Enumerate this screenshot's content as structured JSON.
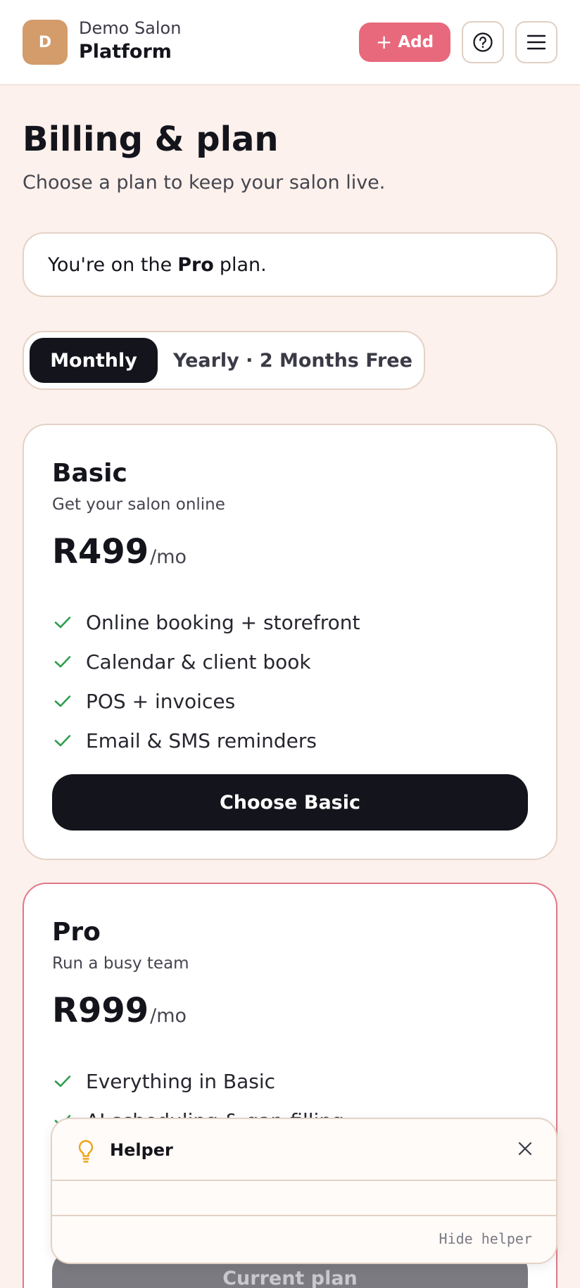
{
  "header": {
    "avatar_initial": "D",
    "salon_name": "Demo Salon",
    "app_title": "Platform",
    "add_label": "Add",
    "icons": {
      "add": "plus-icon",
      "help": "question-circle-icon",
      "menu": "hamburger-menu-icon"
    }
  },
  "page": {
    "title": "Billing & plan",
    "subtitle": "Choose a plan to keep your salon live."
  },
  "banner": {
    "prefix": "You're on the",
    "plan": "Pro",
    "suffix": "plan."
  },
  "billing_toggle": {
    "monthly": "Monthly",
    "yearly": "Yearly · 2 Months Free",
    "selected": "Monthly"
  },
  "plans": [
    {
      "name": "Basic",
      "description": "Get your salon online",
      "price": "R499",
      "unit": "/mo",
      "features": [
        "Online booking + storefront",
        "Calendar & client book",
        "POS + invoices",
        "Email & SMS reminders"
      ],
      "cta": "Choose Basic"
    },
    {
      "name": "Pro",
      "description": "Run a busy team",
      "price": "R999",
      "unit": "/mo",
      "features": [
        "Everything in Basic",
        "AI scheduling & gap-filling"
      ],
      "cta": "Current plan"
    }
  ],
  "helper": {
    "title": "Helper",
    "hide_label": "Hide helper",
    "icons": {
      "bulb": "lightbulb-icon",
      "close": "close-icon"
    }
  },
  "colors": {
    "page_bg": "#fcf1ec",
    "accent": "#e8697c",
    "dark": "#14141c",
    "check": "#2e9e4e",
    "avatar": "#d49c6a",
    "bulb": "#f0a21c"
  }
}
